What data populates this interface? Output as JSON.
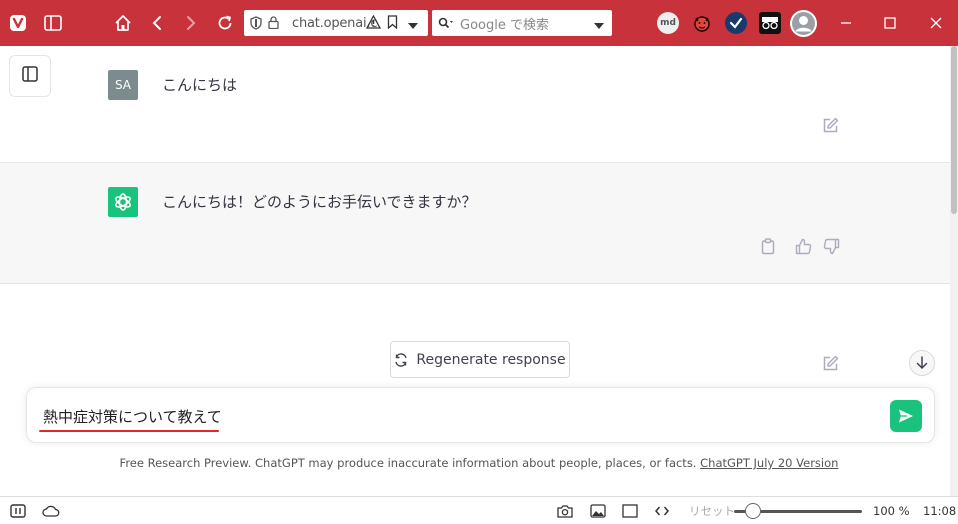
{
  "browser": {
    "url": "chat.openai.c",
    "search_placeholder": "Google で検索",
    "extensions": [
      "md-extension",
      "devil-extension",
      "check-extension",
      "glasses-extension"
    ]
  },
  "conversation": {
    "user": {
      "avatar": "SA",
      "message": "こんにちは"
    },
    "assistant": {
      "message": "こんにちは！どのようにお手伝いできますか？"
    }
  },
  "regenerate_label": "Regenerate response",
  "composer": {
    "value": "熱中症対策について教えて"
  },
  "footer": {
    "text": "Free Research Preview. ChatGPT may produce inaccurate information about people, places, or facts. ",
    "link": "ChatGPT July 20 Version"
  },
  "statusbar": {
    "reset": "リセット",
    "zoom": "100 %",
    "time": "11:08",
    "zoom_level": 0.15
  },
  "colors": {
    "browser_red": "#c8323a",
    "gpt_green": "#19c37d",
    "user_avatar": "#7b8b8e"
  }
}
